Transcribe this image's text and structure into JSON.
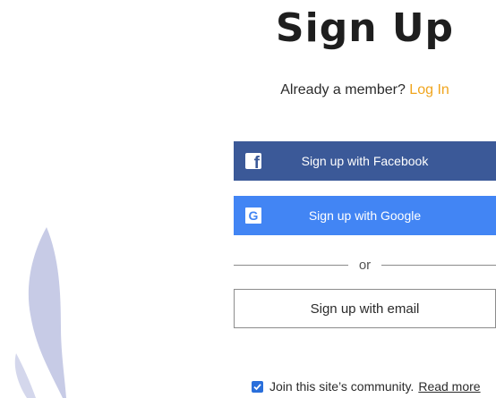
{
  "title": "Sign Up",
  "member_prompt": {
    "text": "Already a member?",
    "login_link": "Log In"
  },
  "social": {
    "facebook_label": "Sign up with Facebook",
    "facebook_icon": "facebook-icon",
    "google_label": "Sign up with Google",
    "google_icon": "google-icon"
  },
  "divider_text": "or",
  "email_button_label": "Sign up with email",
  "community": {
    "checked": true,
    "label": "Join this site’s community.",
    "read_more": "Read more"
  },
  "colors": {
    "facebook": "#3b5998",
    "google": "#4285f4",
    "login_link": "#f0a51e",
    "background_shape": "#c7cbe6"
  }
}
